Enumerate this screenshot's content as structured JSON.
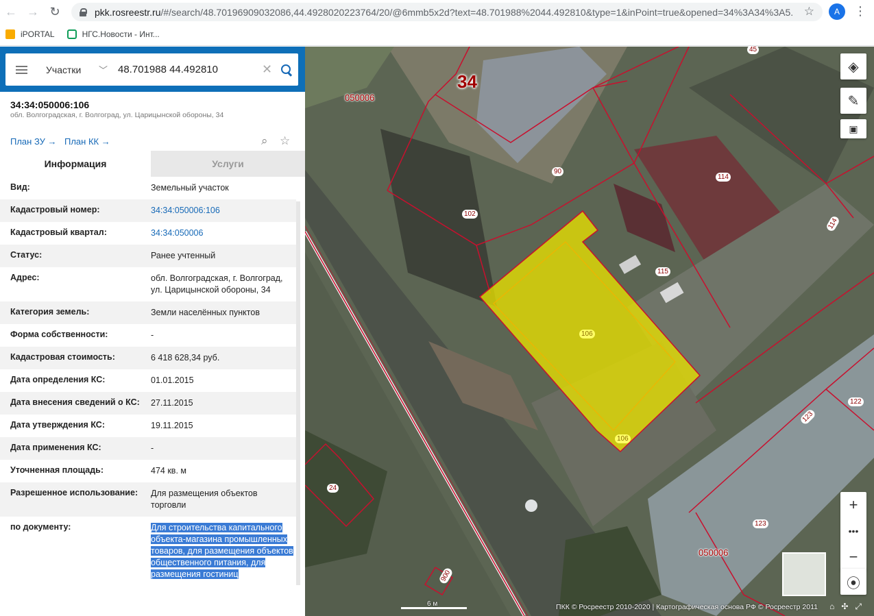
{
  "browser": {
    "url_host": "pkk.rosreestr.ru",
    "url_rest": "/#/search/48.70196909032086,44.4928020223764/20/@6mmb5x2d?text=48.701988%2044.492810&type=1&inPoint=true&opened=34%3A34%3A5...",
    "profile_initial": "A",
    "bookmarks": [
      {
        "label": "iPORTAL",
        "icon": "folder-icon"
      },
      {
        "label": "НГС.Новости - Инт...",
        "icon": "ngs-icon"
      }
    ]
  },
  "search": {
    "type_label": "Участки",
    "query": "48.701988 44.492810"
  },
  "object": {
    "number": "34:34:050006:106",
    "address": "обл. Волгоградская, г. Волгоград, ул. Царицынской обороны, 34",
    "plan_zu": "План ЗУ →",
    "plan_kk": "План КК →"
  },
  "tabs": {
    "info": "Информация",
    "services": "Услуги"
  },
  "details": [
    {
      "k": "Вид:",
      "v": "Земельный участок"
    },
    {
      "k": "Кадастровый номер:",
      "v": "34:34:050006:106"
    },
    {
      "k": "Кадастровый квартал:",
      "v": "34:34:050006"
    },
    {
      "k": "Статус:",
      "v": "Ранее учтенный"
    },
    {
      "k": "Адрес:",
      "v": "обл. Волгоградская, г. Волгоград, ул. Царицынской обороны, 34"
    },
    {
      "k": "Категория земель:",
      "v": "Земли населённых пунктов"
    },
    {
      "k": "Форма собственности:",
      "v": "-"
    },
    {
      "k": "Кадастровая стоимость:",
      "v": "6 418 628,34 руб."
    },
    {
      "k": "Дата определения КС:",
      "v": "01.01.2015"
    },
    {
      "k": "Дата внесения сведений о КС:",
      "v": "27.11.2015"
    },
    {
      "k": "Дата утверждения КС:",
      "v": "19.11.2015"
    },
    {
      "k": "Дата применения КС:",
      "v": "-"
    },
    {
      "k": "Уточненная площадь:",
      "v": "474 кв. м"
    },
    {
      "k": "Разрешенное использование:",
      "v": "Для размещения объектов торговли"
    },
    {
      "k": "по документу:",
      "v": "Для строительства капитального объекта-магазина промышленных товаров, для размещения объектов общественного питания, для размещения гостиниц"
    }
  ],
  "map": {
    "labels": {
      "big": "34",
      "q_top": "050006",
      "q_bottom": "050006",
      "p45": "45",
      "p90": "90",
      "p102": "102",
      "p114a": "114",
      "p114b": "114",
      "p115": "115",
      "p106a": "106",
      "p106b": "106",
      "p122": "122",
      "p123a": "123",
      "p123b": "123",
      "p24": "24",
      "p900": "900"
    },
    "scale": "6 м",
    "copyright": "ПКК © Росреестр 2010-2020 | Картографическая основа РФ © Росреестр 2011",
    "colors": {
      "parcel_border": "#c8102e",
      "selected_fill": "#e8e000",
      "panel_header": "#0e6fb8"
    }
  }
}
